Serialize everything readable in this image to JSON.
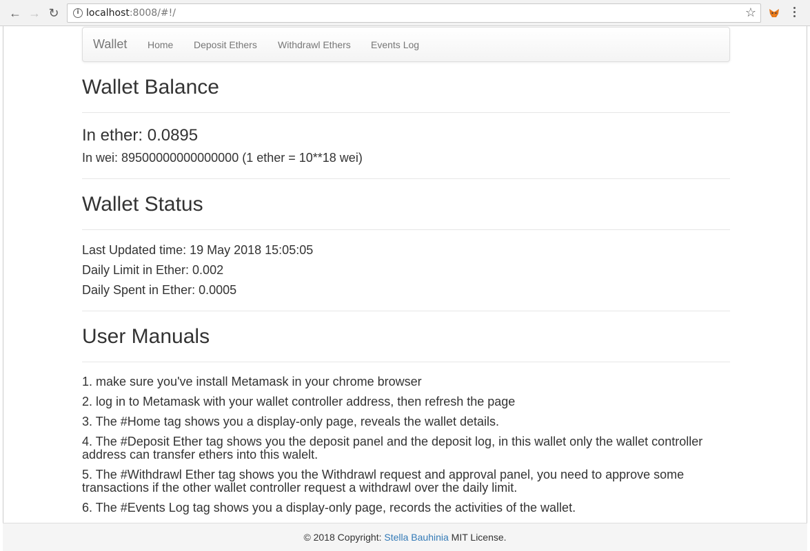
{
  "browser": {
    "url_host": "localhost",
    "url_rest": ":8008/#!/"
  },
  "navbar": {
    "brand": "Wallet",
    "links": [
      "Home",
      "Deposit Ethers",
      "Withdrawl Ethers",
      "Events Log"
    ]
  },
  "balance": {
    "title": "Wallet Balance",
    "ether": "In ether: 0.0895",
    "wei": "In wei: 89500000000000000 (1 ether = 10**18 wei)"
  },
  "status": {
    "title": "Wallet Status",
    "last_updated": "Last Updated time: 19 May 2018 15:05:05",
    "daily_limit": "Daily Limit in Ether: 0.002",
    "daily_spent": "Daily Spent in Ether: 0.0005"
  },
  "manual": {
    "title": "User Manuals",
    "items": [
      "1. make sure you've install Metamask in your chrome browser",
      "2. log in to Metamask with your wallet controller address, then refresh the page",
      "3. The #Home tag shows you a display-only page, reveals the wallet details.",
      "4. The #Deposit Ether tag shows you the deposit panel and the deposit log, in this wallet only the wallet controller address can transfer ethers into this walelt.",
      "5. The #Withdrawl Ether tag shows you the Withdrawl request and approval panel, you need to approve some transactions if the other wallet controller request a withdrawl over the daily limit.",
      "6. The #Events Log tag shows you a display-only page, records the activities of the wallet."
    ]
  },
  "footer": {
    "prefix": "© 2018 Copyright: ",
    "author": "Stella Bauhinia",
    "suffix": " MIT License."
  },
  "icons": [
    "back-arrow-icon",
    "forward-arrow-icon",
    "reload-icon",
    "info-icon",
    "bookmark-star-icon",
    "metamask-fox-icon",
    "menu-dots-icon"
  ]
}
